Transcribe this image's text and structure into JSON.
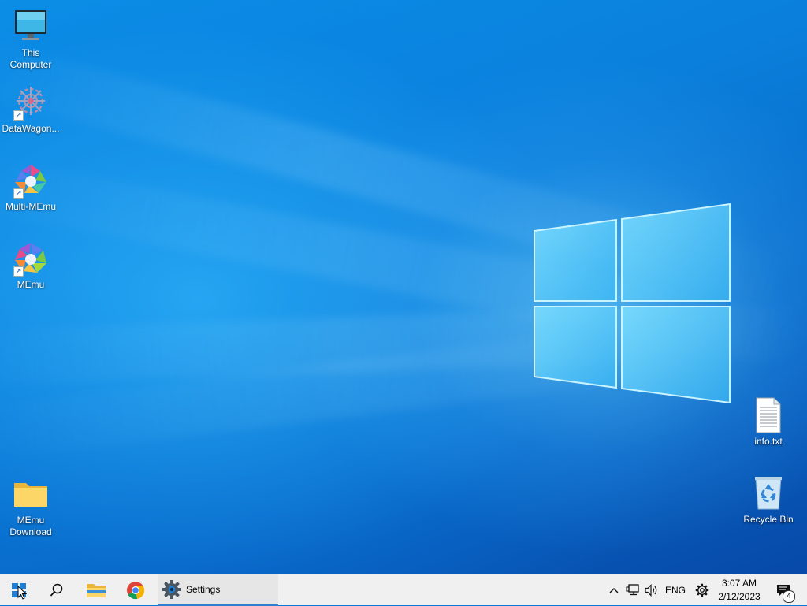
{
  "desktop": {
    "icons": [
      {
        "label": "This\nComputer",
        "icon": "monitor-icon"
      },
      {
        "label": "DataWagon...",
        "icon": "datawagon-icon",
        "shortcut": true
      },
      {
        "label": "Multi-MEmu",
        "icon": "multi-memu-icon",
        "shortcut": true
      },
      {
        "label": "MEmu",
        "icon": "memu-icon",
        "shortcut": true
      },
      {
        "label": "MEmu\nDownload",
        "icon": "folder-icon"
      },
      {
        "label": "info.txt",
        "icon": "text-file-icon"
      },
      {
        "label": "Recycle Bin",
        "icon": "recycle-bin-icon"
      }
    ]
  },
  "taskbar": {
    "start_icon": "windows-logo-icon",
    "search_icon": "search-icon",
    "pinned": [
      {
        "name": "File Explorer",
        "icon": "folder-icon"
      },
      {
        "name": "Google Chrome",
        "icon": "chrome-icon"
      }
    ],
    "active_app": {
      "label": "Settings",
      "icon": "gear-icon"
    },
    "tray": {
      "chevron_icon": "chevron-up-icon",
      "network_icon": "network-icon",
      "volume_icon": "speaker-icon",
      "language": "ENG",
      "settings_icon": "gear-icon",
      "time": "3:07 AM",
      "date": "2/12/2023",
      "notification_count": "4"
    }
  },
  "colors": {
    "desktop_blue": "#0a78d7",
    "taskbar_bg": "#f0f0f0",
    "active_indicator": "#2f7fd0"
  }
}
